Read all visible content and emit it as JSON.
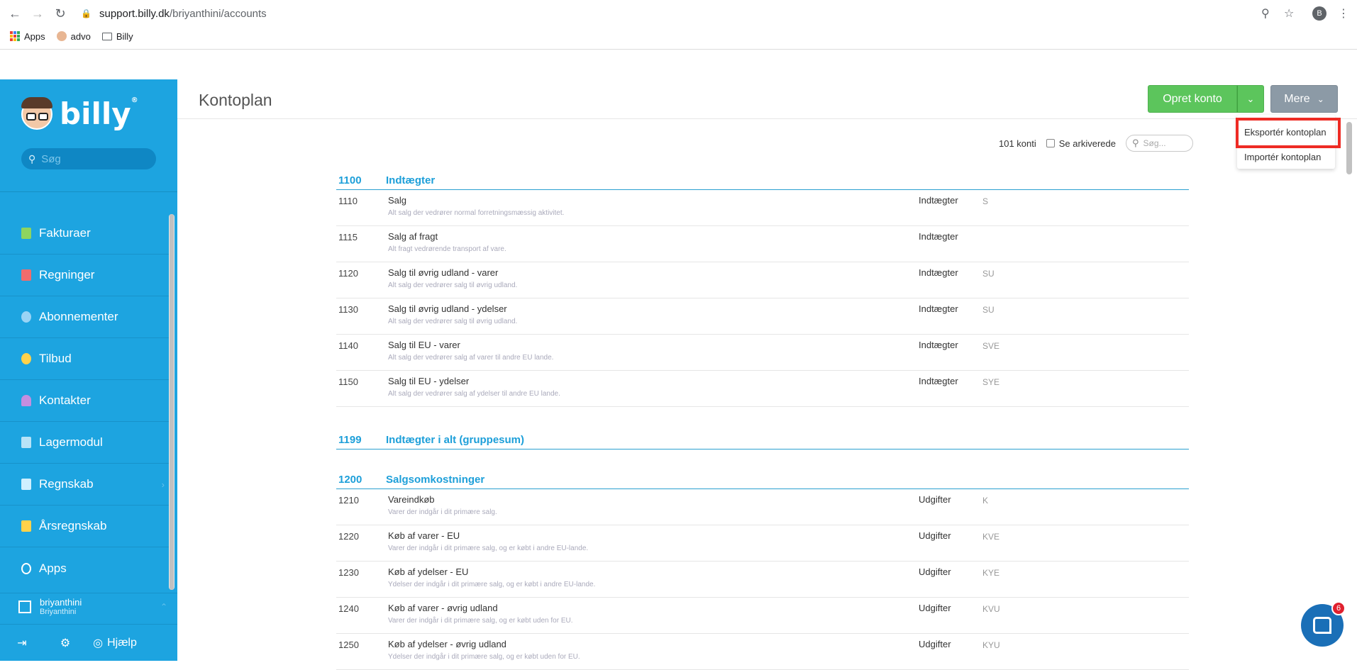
{
  "browser": {
    "url_host": "support.billy.dk",
    "url_path": "/briyanthini/accounts",
    "profile_initial": "B",
    "bookmarks": [
      {
        "label": "Apps",
        "icon": "apps-grid-icon"
      },
      {
        "label": "advo",
        "icon": "advo-favicon"
      },
      {
        "label": "Billy",
        "icon": "folder-icon"
      }
    ]
  },
  "sidebar": {
    "logo_text": "billy",
    "logo_mark": "®",
    "search_placeholder": "Søg",
    "items": [
      {
        "label": "Fakturaer",
        "icon": "invoice-icon",
        "color": "#8ed45f"
      },
      {
        "label": "Regninger",
        "icon": "bill-icon",
        "color": "#f06c6c"
      },
      {
        "label": "Abonnementer",
        "icon": "subscription-icon",
        "color": "#9ad4f5"
      },
      {
        "label": "Tilbud",
        "icon": "quote-icon",
        "color": "#ffd24a"
      },
      {
        "label": "Kontakter",
        "icon": "contacts-icon",
        "color": "#c48ee0"
      },
      {
        "label": "Lagermodul",
        "icon": "inventory-icon",
        "color": "#b8e3f7"
      },
      {
        "label": "Regnskab",
        "icon": "accounting-icon",
        "color": "#cfefff"
      },
      {
        "label": "Årsregnskab",
        "icon": "annual-report-icon",
        "color": "#ffd24a"
      },
      {
        "label": "Apps",
        "icon": "apps-icon",
        "color": "#ffffff"
      }
    ],
    "user": {
      "name": "briyanthini",
      "org": "Briyanthini"
    },
    "footer": {
      "help_label": "Hjælp"
    }
  },
  "main": {
    "title": "Kontoplan",
    "create_button": "Opret konto",
    "more_button": "Mere",
    "dropdown": {
      "export_label": "Eksportér kontoplan",
      "import_label": "Importér kontoplan"
    },
    "count_label": "101 konti",
    "archived_label": "Se arkiverede",
    "search_placeholder": "Søg..."
  },
  "accounts": {
    "group1": {
      "number": "1100",
      "name": "Indtægter"
    },
    "rows1": [
      {
        "number": "1110",
        "name": "Salg",
        "desc": "Alt salg der vedrører normal forretningsmæssig aktivitet.",
        "type": "Indtægter",
        "vat": "S"
      },
      {
        "number": "1115",
        "name": "Salg af fragt",
        "desc": "Alt fragt vedrørende transport af vare.",
        "type": "Indtægter",
        "vat": ""
      },
      {
        "number": "1120",
        "name": "Salg til øvrig udland - varer",
        "desc": "Alt salg der vedrører salg til øvrig udland.",
        "type": "Indtægter",
        "vat": "SU"
      },
      {
        "number": "1130",
        "name": "Salg til øvrig udland - ydelser",
        "desc": "Alt salg der vedrører salg til øvrig udland.",
        "type": "Indtægter",
        "vat": "SU"
      },
      {
        "number": "1140",
        "name": "Salg til EU - varer",
        "desc": "Alt salg der vedrører salg af varer til andre EU lande.",
        "type": "Indtægter",
        "vat": "SVE"
      },
      {
        "number": "1150",
        "name": "Salg til EU - ydelser",
        "desc": "Alt salg der vedrører salg af ydelser til andre EU lande.",
        "type": "Indtægter",
        "vat": "SYE"
      }
    ],
    "group2": {
      "number": "1199",
      "name": "Indtægter i alt (gruppesum)"
    },
    "group3": {
      "number": "1200",
      "name": "Salgsomkostninger"
    },
    "rows3": [
      {
        "number": "1210",
        "name": "Vareindkøb",
        "desc": "Varer der indgår i dit primære salg.",
        "type": "Udgifter",
        "vat": "K"
      },
      {
        "number": "1220",
        "name": "Køb af varer - EU",
        "desc": "Varer der indgår i dit primære salg, og er købt i andre EU-lande.",
        "type": "Udgifter",
        "vat": "KVE"
      },
      {
        "number": "1230",
        "name": "Køb af ydelser - EU",
        "desc": "Ydelser der indgår i dit primære salg, og er købt i andre EU-lande.",
        "type": "Udgifter",
        "vat": "KYE"
      },
      {
        "number": "1240",
        "name": "Køb af varer - øvrig udland",
        "desc": "Varer der indgår i dit primære salg, og er købt uden for EU.",
        "type": "Udgifter",
        "vat": "KVU"
      },
      {
        "number": "1250",
        "name": "Køb af ydelser - øvrig udland",
        "desc": "Ydelser der indgår i dit primære salg, og er købt uden for EU.",
        "type": "Udgifter",
        "vat": "KYU"
      }
    ]
  },
  "chat": {
    "badge_count": "6"
  }
}
